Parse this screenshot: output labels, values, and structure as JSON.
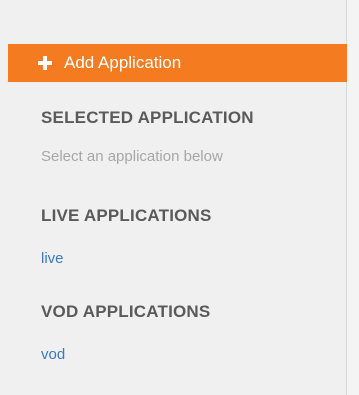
{
  "add_button": {
    "label": "Add Application",
    "icon": "plus-icon",
    "color": "#f47b20"
  },
  "selected": {
    "heading": "SELECTED APPLICATION",
    "hint": "Select an application below"
  },
  "live": {
    "heading": "LIVE APPLICATIONS",
    "items": [
      {
        "label": "live"
      }
    ]
  },
  "vod": {
    "heading": "VOD APPLICATIONS",
    "items": [
      {
        "label": "vod"
      }
    ]
  },
  "colors": {
    "link": "#3a79c2",
    "heading": "#5a5a5a",
    "hint": "#a6a6a6"
  }
}
